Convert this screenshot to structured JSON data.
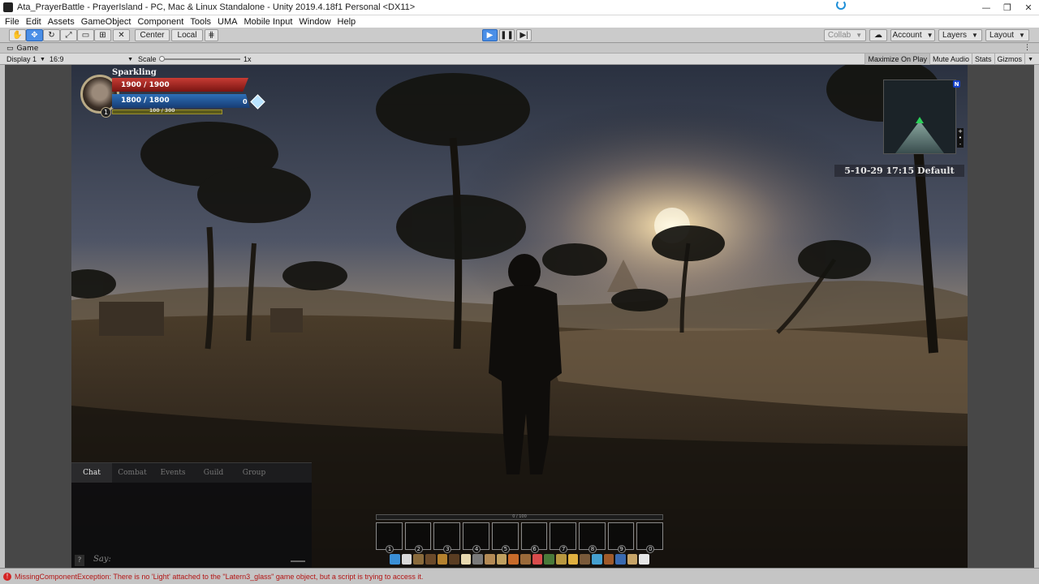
{
  "window": {
    "title": "Ata_PrayerBattle - PrayerIsland - PC, Mac & Linux Standalone - Unity 2019.4.18f1 Personal <DX11>",
    "controls": [
      "—",
      "❐",
      "✕"
    ]
  },
  "menu": [
    "File",
    "Edit",
    "Assets",
    "GameObject",
    "Component",
    "Tools",
    "UMA",
    "Mobile Input",
    "Window",
    "Help"
  ],
  "toolbar": {
    "pivot_label": "Center",
    "space_label": "Local",
    "collab_label": "Collab",
    "account_label": "Account",
    "layers_label": "Layers",
    "layout_label": "Layout"
  },
  "game_tab": {
    "label": "Game",
    "display": "Display 1",
    "aspect": "16:9",
    "scale_label": "Scale",
    "scale_value": "1x",
    "toggles": [
      "Maximize On Play",
      "Mute Audio",
      "Stats",
      "Gizmos"
    ]
  },
  "hud": {
    "player_name": "Sparkling",
    "level": "1",
    "hp": "1900 / 1900",
    "mp": "1800 / 1800",
    "xp_text": "100 / 300",
    "currency": "0",
    "datetime": "5-10-29 17:15 Default",
    "compass": "N",
    "map_controls": [
      "+",
      "•",
      "-"
    ]
  },
  "chat": {
    "tabs": [
      "Chat",
      "Combat",
      "Events",
      "Guild",
      "Group"
    ],
    "help": "?",
    "say_placeholder": "Say:"
  },
  "actionbar": {
    "xp_text": "0 / 100",
    "slots": [
      "1",
      "2",
      "3",
      "4",
      "5",
      "6",
      "7",
      "8",
      "9",
      "0"
    ],
    "skill_colors": [
      "#3a8fd6",
      "#d9d9d9",
      "#8a6b3c",
      "#6b4a2a",
      "#b5822f",
      "#5a3d22",
      "#e8d9b0",
      "#7a7a7a",
      "#b48a55",
      "#c0a060",
      "#c86b2a",
      "#9b6a3a",
      "#d94c4c",
      "#4a7a3a",
      "#b99840",
      "#e0b040",
      "#7a5a3a",
      "#45a0d0",
      "#a05a2a",
      "#3a6ab0",
      "#c7a468",
      "#e6e6e6"
    ]
  },
  "status": {
    "message": "MissingComponentException: There is no 'Light' attached to the \"Latern3_glass\" game object, but a script is trying to access it."
  },
  "colors": {
    "play_active": "#4a8fe7",
    "error_text": "#b31414",
    "hp": "#c83c34",
    "mp": "#2e6fb8"
  }
}
